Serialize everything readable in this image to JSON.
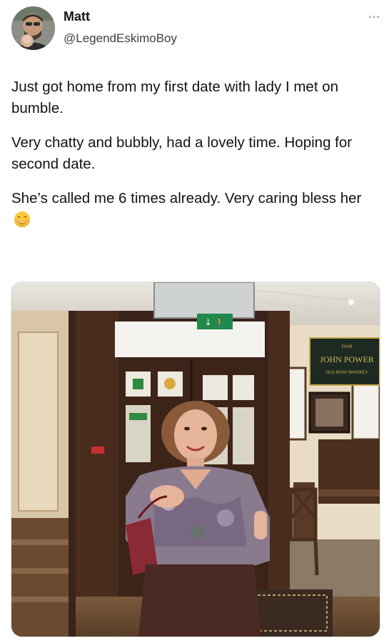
{
  "tweet": {
    "author": {
      "name": "Matt",
      "handle": "@LegendEskimoBoy"
    },
    "more_icon": "more-dots-icon",
    "paragraphs": [
      "Just got home from my first date with lady I met on bumble.",
      "Very chatty and bubbly, had a lovely time. Hoping for second date.",
      "She’s called me 6 times already. Very caring bless her"
    ],
    "emoji": "smiling-face-with-smiling-eyes",
    "photo": {
      "sign_text": "JOHN POWER",
      "sign_subtext": "OLD IRISH WHISKEY",
      "sign_top": "Irish"
    }
  },
  "colors": {
    "text": "#0f1419",
    "secondary": "#536471",
    "accent_green": "#1f8a4c"
  }
}
